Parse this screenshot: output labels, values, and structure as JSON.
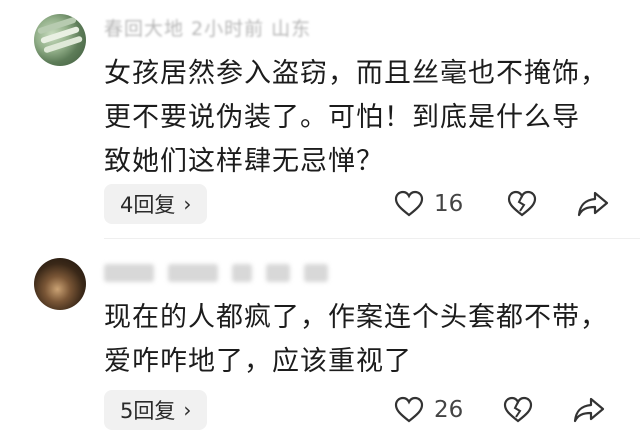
{
  "comments": [
    {
      "meta": "春回大地 2小时前 山东",
      "text_lines": [
        "女孩居然参入盗窃，而且丝毫也不掩饰，",
        "更不要说伪装了。可怕！到底是什么导",
        "致她们这样肆无忌惮？"
      ],
      "reply_label": "4回复",
      "like_count": "16"
    },
    {
      "meta": "",
      "text_lines": [
        "现在的人都疯了，作案连个头套都不带，",
        "爱咋咋地了，应该重视了"
      ],
      "reply_label": "5回复",
      "like_count": "26"
    }
  ],
  "icons": {
    "like": "heart-outline-icon",
    "dislike": "broken-heart-icon",
    "share": "share-arrow-icon"
  }
}
